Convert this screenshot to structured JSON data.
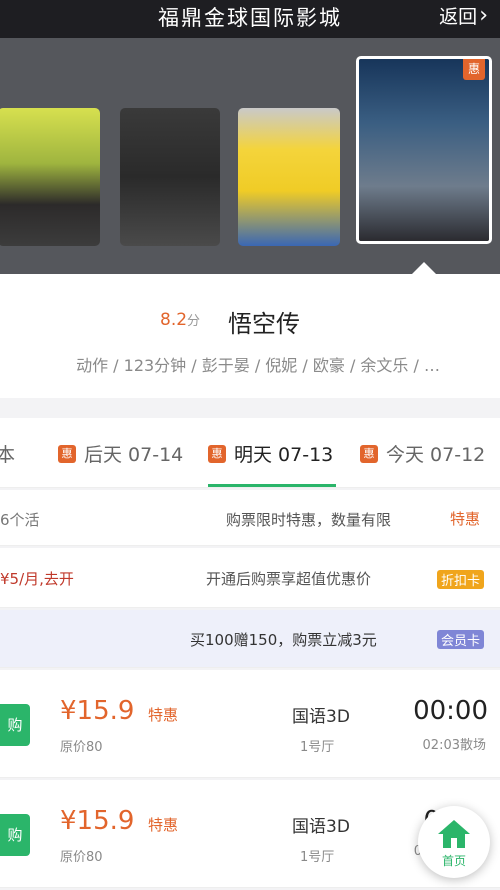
{
  "header": {
    "title": "福鼎金球国际影城",
    "back_label": "返回"
  },
  "posters": [
    {
      "name": "poster-1",
      "tag": ""
    },
    {
      "name": "poster-2",
      "tag": ""
    },
    {
      "name": "poster-3",
      "tag": ""
    },
    {
      "name": "poster-4",
      "tag": "惠",
      "selected": true
    }
  ],
  "movie": {
    "title": "悟空传",
    "score": "8.2",
    "score_unit": "分",
    "meta": "动作 / 123分钟 / 彭于晏 / 倪妮 / 欧豪 / 余文乐 / …"
  },
  "tabs": [
    {
      "label": "今天 07-12",
      "badge": "惠"
    },
    {
      "label": "明天 07-13",
      "badge": "惠",
      "active": true
    },
    {
      "label": "后天 07-14",
      "badge": "惠"
    },
    {
      "label": "本",
      "badge": ""
    }
  ],
  "promos": [
    {
      "label": "特惠",
      "text": "购票限时特惠，数量有限",
      "right": "6个活"
    },
    {
      "label": "折扣卡",
      "text": "开通后购票享超值优惠价",
      "right": "¥5/月,去开"
    },
    {
      "label": "会员卡",
      "text": "买100赠150，购票立减3元",
      "right": ""
    }
  ],
  "showtimes": [
    {
      "time": "00:00",
      "end": "02:03散场",
      "lang": "国语3D",
      "hall": "1号厅",
      "tehui": "特惠",
      "price": "¥15.9",
      "orig": "原价80",
      "buy": "购"
    },
    {
      "time": "0",
      "end": "0",
      "lang": "国语3D",
      "hall": "1号厅",
      "tehui": "特惠",
      "price": "¥15.9",
      "orig": "原价80",
      "buy": "购"
    }
  ],
  "home": {
    "label": "首页"
  },
  "colors": {
    "accent_green": "#2bb56a",
    "accent_orange": "#e2652c",
    "header_bg": "#1e1e22"
  }
}
